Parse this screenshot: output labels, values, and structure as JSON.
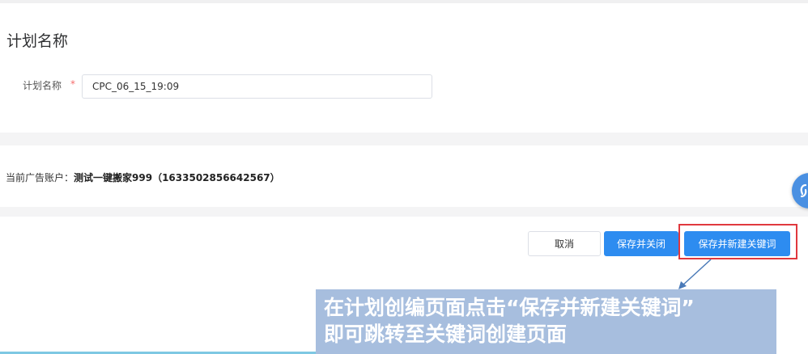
{
  "plan_section": {
    "title": "计划名称",
    "field_label": "计划名称",
    "required_mark": "*",
    "input_value": "CPC_06_15_19:09"
  },
  "account": {
    "label": "当前广告账户：",
    "value": "测试一键搬家999（1633502856642567）"
  },
  "actions": {
    "cancel_label": "取消",
    "save_close_label": "保存并关闭",
    "save_new_keyword_label": "保存并新建关键词"
  },
  "callout": {
    "line1": "在计划创编页面点击“保存并新建关键词”",
    "line2": "即可跳转至关键词创建页面"
  },
  "colors": {
    "primary": "#2d8cf0",
    "highlight": "#e0383e",
    "callout_bg": "#a7bede",
    "required": "#f56c6c"
  },
  "icons": {
    "floating_widget": "link-icon"
  }
}
